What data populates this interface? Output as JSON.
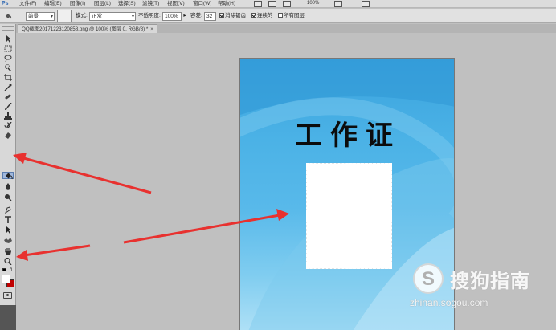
{
  "app": {
    "logo": "Ps"
  },
  "menubar": {
    "items": [
      "文件(F)",
      "编辑(E)",
      "图像(I)",
      "图层(L)",
      "选择(S)",
      "滤镜(T)",
      "视图(V)",
      "窗口(W)",
      "帮助(H)"
    ],
    "zoom": "100%"
  },
  "options_bar": {
    "fill_source": "前景",
    "mode_label": "模式:",
    "mode_value": "正常",
    "opacity_label": "不透明度:",
    "opacity_value": "100%",
    "tolerance_label": "容差:",
    "tolerance_value": "32",
    "antialias_label": "消除锯齿",
    "antialias_checked": true,
    "contiguous_label": "连续的",
    "contiguous_checked": true,
    "all_layers_label": "所有图层",
    "all_layers_checked": false
  },
  "document_tab": {
    "title": "QQ截图20171223120858.png @ 100% (图层 0, RGB/8) *",
    "close_glyph": "×"
  },
  "toolbox": {
    "tools": [
      "move-tool",
      "marquee-tool",
      "lasso-tool",
      "quick-selection-tool",
      "crop-tool",
      "eyedropper-tool",
      "healing-brush-tool",
      "brush-tool",
      "clone-stamp-tool",
      "history-brush-tool",
      "eraser-tool",
      "paint-bucket-tool",
      "blur-tool",
      "dodge-tool",
      "pen-tool",
      "type-tool",
      "path-selection-tool",
      "shape-tool",
      "hand-tool",
      "zoom-tool"
    ],
    "active_tool": "paint-bucket-tool",
    "foreground_color": "#ffffff",
    "background_color": "#c00000"
  },
  "canvas": {
    "title": "工作证",
    "background_color": "#4bb2e6"
  },
  "annotations": {
    "arrow_color": "#e8312f"
  },
  "watermark": {
    "name": "搜狗指南",
    "url": "zhinan.sogou.com"
  }
}
